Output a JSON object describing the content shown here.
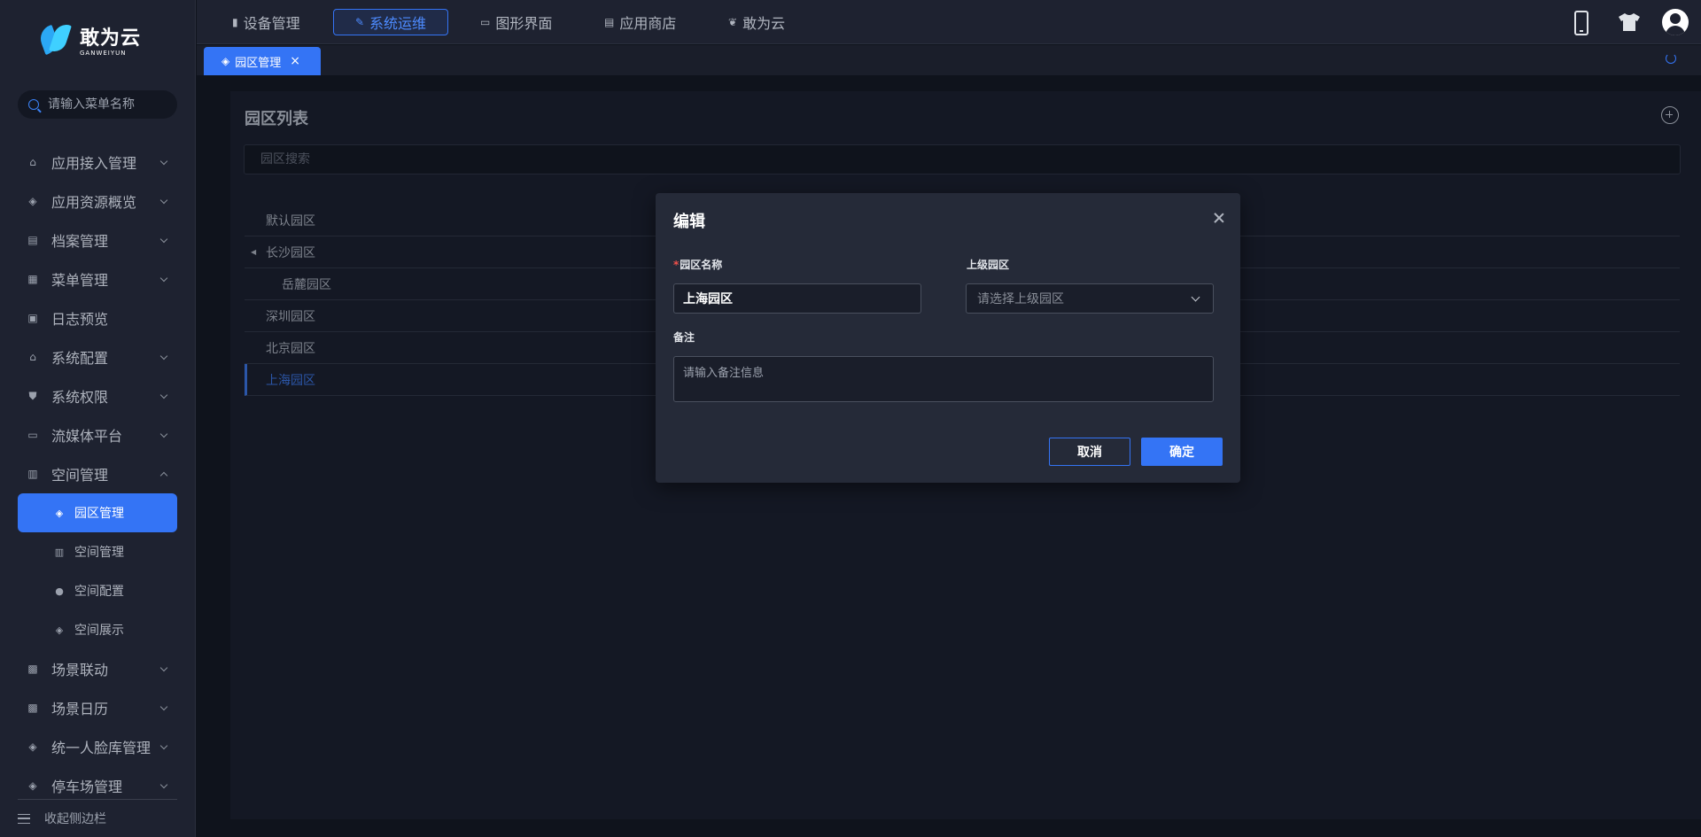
{
  "brand": {
    "name_cn": "敢为云",
    "name_en": "GANWEIYUN"
  },
  "sidebar": {
    "search_placeholder": "请输入菜单名称",
    "items": [
      {
        "label": "应用接入管理",
        "icon": "home-icon",
        "expandable": true
      },
      {
        "label": "应用资源概览",
        "icon": "layers-icon",
        "expandable": true
      },
      {
        "label": "档案管理",
        "icon": "archive-icon",
        "expandable": true
      },
      {
        "label": "菜单管理",
        "icon": "menu-table-icon",
        "expandable": true
      },
      {
        "label": "日志预览",
        "icon": "log-icon",
        "expandable": false
      },
      {
        "label": "系统配置",
        "icon": "home-icon",
        "expandable": true
      },
      {
        "label": "系统权限",
        "icon": "shield-icon",
        "expandable": true
      },
      {
        "label": "流媒体平台",
        "icon": "image-icon",
        "expandable": true
      },
      {
        "label": "空间管理",
        "icon": "building-icon",
        "expandable": true,
        "expanded": true
      }
    ],
    "sub_items": [
      {
        "label": "园区管理",
        "icon": "layers-icon",
        "active": true
      },
      {
        "label": "空间管理",
        "icon": "building-icon"
      },
      {
        "label": "空间配置",
        "icon": "location-pin-icon"
      },
      {
        "label": "空间展示",
        "icon": "layers-icon"
      }
    ],
    "items_after": [
      {
        "label": "场景联动",
        "icon": "scene-icon",
        "expandable": true
      },
      {
        "label": "场景日历",
        "icon": "scene-icon",
        "expandable": true
      },
      {
        "label": "统一人脸库管理",
        "icon": "layers-icon",
        "expandable": true
      },
      {
        "label": "停车场管理",
        "icon": "layers-icon",
        "expandable": true
      }
    ],
    "collapse_label": "收起侧边栏"
  },
  "topnav": {
    "tabs": [
      {
        "label": "设备管理",
        "icon": "device-icon"
      },
      {
        "label": "系统运维",
        "icon": "wrench-icon",
        "active": true
      },
      {
        "label": "图形界面",
        "icon": "monitor-icon"
      },
      {
        "label": "应用商店",
        "icon": "store-icon"
      },
      {
        "label": "敢为云",
        "icon": "butterfly-icon"
      }
    ]
  },
  "page_tabs": [
    {
      "label": "园区管理",
      "icon": "layers-icon"
    }
  ],
  "main": {
    "title": "园区列表",
    "search_placeholder": "园区搜索",
    "tree": [
      {
        "label": "默认园区",
        "level": 0
      },
      {
        "label": "长沙园区",
        "level": 0,
        "has_children": true
      },
      {
        "label": "岳麓园区",
        "level": 1
      },
      {
        "label": "深圳园区",
        "level": 0
      },
      {
        "label": "北京园区",
        "level": 0
      },
      {
        "label": "上海园区",
        "level": 0,
        "active": true
      }
    ]
  },
  "modal": {
    "title": "编辑",
    "name_label": "园区名称",
    "name_required_mark": "*",
    "name_value": "上海园区",
    "parent_label": "上级园区",
    "parent_placeholder": "请选择上级园区",
    "remark_label": "备注",
    "remark_placeholder": "请输入备注信息",
    "cancel_label": "取消",
    "ok_label": "确定"
  },
  "colors": {
    "accent": "#3474f5",
    "sidebar_bg": "#1e2230",
    "page_bg": "#0f131c",
    "modal_bg": "#252a38",
    "required": "#f5514b"
  }
}
